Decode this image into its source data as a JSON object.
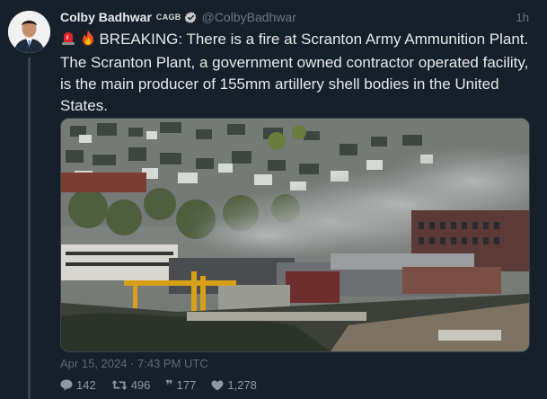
{
  "tweet": {
    "display_name": "Colby Badhwar",
    "affiliate_badge": "CAGB",
    "handle": "@ColbyBadhwar",
    "time_ago": "1h",
    "text": "BREAKING: There is a fire at Scranton Army Ammunition Plant. The Scranton Plant, a government owned contractor operated facility, is the main producer of 155mm artillery shell bodies in the United States.",
    "emojis": [
      "siren-icon",
      "fire-icon"
    ],
    "timestamp": "Apr 15, 2024 · 7:43 PM UTC",
    "stats": {
      "replies": "142",
      "retweets": "496",
      "quotes": "177",
      "likes": "1,278"
    }
  },
  "colors": {
    "background": "#15202b",
    "verified": "#1d9bf0",
    "muted": "#6e767d"
  }
}
